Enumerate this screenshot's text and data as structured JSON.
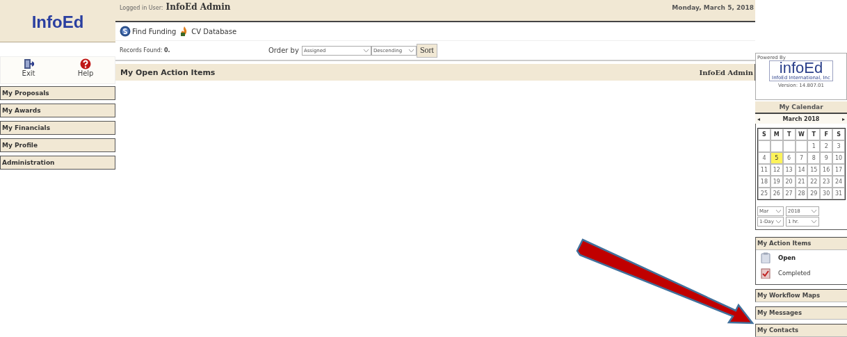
{
  "logo": {
    "text": "InfoEd"
  },
  "header": {
    "user_label": "Logged in User:",
    "user_name": "InfoEd Admin",
    "date": "Monday, March 5, 2018"
  },
  "nav_links": [
    {
      "label": "Find Funding",
      "kind": "funding"
    },
    {
      "label": "CV Database",
      "kind": "cv"
    }
  ],
  "quick_actions": [
    {
      "label": "Exit",
      "kind": "exit"
    },
    {
      "label": "Help",
      "kind": "help"
    }
  ],
  "sidebar": {
    "items": [
      {
        "label": "My Proposals"
      },
      {
        "label": "My Awards"
      },
      {
        "label": "My Financials"
      },
      {
        "label": "My Profile"
      },
      {
        "label": "Administration"
      }
    ]
  },
  "records": {
    "label": "Records Found:",
    "count": "0."
  },
  "order": {
    "label": "Order by",
    "field": "Assigned",
    "direction": "Descending",
    "button": "Sort"
  },
  "panel": {
    "title": "My Open Action Items",
    "owner": "InfoEd Admin"
  },
  "powered_by": {
    "label": "Powered By",
    "brand": "infoEd",
    "company": "InfoEd International, Inc",
    "version": "Version: 14.807.01"
  },
  "calendar": {
    "title": "My Calendar",
    "month": "March 2018",
    "prev": "◂",
    "next": "▸",
    "weekdays": [
      "S",
      "M",
      "T",
      "W",
      "T",
      "F",
      "S"
    ],
    "weeks": [
      [
        {
          "kind": "blank"
        },
        {
          "kind": "blank"
        },
        {
          "kind": "blank"
        },
        {
          "kind": "blank"
        },
        {
          "kind": "day",
          "day": "1",
          "selected": false
        },
        {
          "kind": "day",
          "day": "2",
          "selected": false
        },
        {
          "kind": "day",
          "day": "3",
          "selected": false
        }
      ],
      [
        {
          "kind": "day",
          "day": "4",
          "selected": false
        },
        {
          "kind": "day",
          "day": "5",
          "selected": true
        },
        {
          "kind": "day",
          "day": "6",
          "selected": false
        },
        {
          "kind": "day",
          "day": "7",
          "selected": false
        },
        {
          "kind": "day",
          "day": "8",
          "selected": false
        },
        {
          "kind": "day",
          "day": "9",
          "selected": false
        },
        {
          "kind": "day",
          "day": "10",
          "selected": false
        }
      ],
      [
        {
          "kind": "day",
          "day": "11",
          "selected": false
        },
        {
          "kind": "day",
          "day": "12",
          "selected": false
        },
        {
          "kind": "day",
          "day": "13",
          "selected": false
        },
        {
          "kind": "day",
          "day": "14",
          "selected": false
        },
        {
          "kind": "day",
          "day": "15",
          "selected": false
        },
        {
          "kind": "day",
          "day": "16",
          "selected": false
        },
        {
          "kind": "day",
          "day": "17",
          "selected": false
        }
      ],
      [
        {
          "kind": "day",
          "day": "18",
          "selected": false
        },
        {
          "kind": "day",
          "day": "19",
          "selected": false
        },
        {
          "kind": "day",
          "day": "20",
          "selected": false
        },
        {
          "kind": "day",
          "day": "21",
          "selected": false
        },
        {
          "kind": "day",
          "day": "22",
          "selected": false
        },
        {
          "kind": "day",
          "day": "23",
          "selected": false
        },
        {
          "kind": "day",
          "day": "24",
          "selected": false
        }
      ],
      [
        {
          "kind": "day",
          "day": "25",
          "selected": false
        },
        {
          "kind": "day",
          "day": "26",
          "selected": false
        },
        {
          "kind": "day",
          "day": "27",
          "selected": false
        },
        {
          "kind": "day",
          "day": "28",
          "selected": false
        },
        {
          "kind": "day",
          "day": "29",
          "selected": false
        },
        {
          "kind": "day",
          "day": "30",
          "selected": false
        },
        {
          "kind": "day",
          "day": "31",
          "selected": false
        }
      ]
    ],
    "selects": [
      [
        "Mar",
        "2018"
      ],
      [
        "1-Day",
        "1 hr."
      ]
    ]
  },
  "action_items": {
    "title": "My Action Items",
    "links": [
      {
        "label": "Open",
        "kind": "open"
      },
      {
        "label": "Completed",
        "kind": "completed"
      }
    ]
  },
  "right_sections": [
    {
      "label": "My Workflow Maps"
    },
    {
      "label": "My Messages"
    },
    {
      "label": "My Contacts"
    }
  ],
  "annotation": {
    "kind": "arrow"
  }
}
